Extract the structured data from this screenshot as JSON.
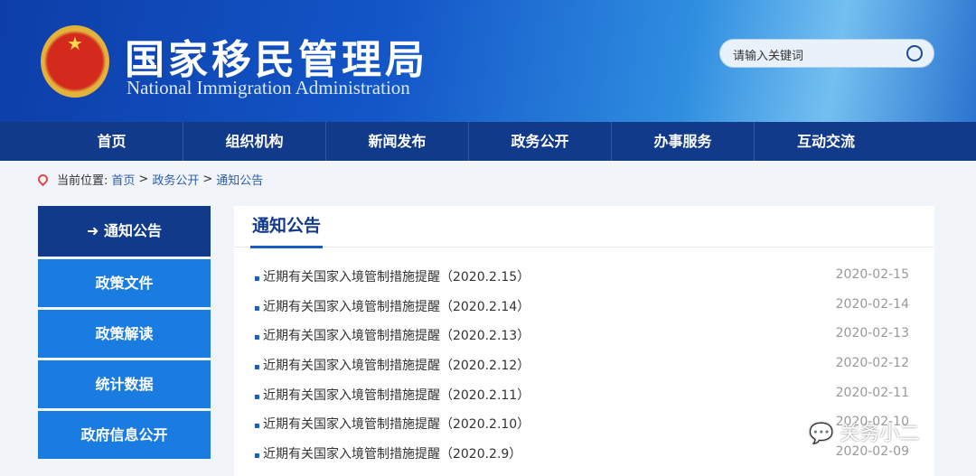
{
  "header": {
    "title": "国家移民管理局",
    "subtitle": "National Immigration Administration",
    "search_placeholder": "请输入关键词"
  },
  "nav": [
    "首页",
    "组织机构",
    "新闻发布",
    "政务公开",
    "办事服务",
    "互动交流"
  ],
  "breadcrumb": {
    "label": "当前位置:",
    "items": [
      "首页",
      "政务公开",
      "通知公告"
    ],
    "sep": ">"
  },
  "sidebar": [
    "通知公告",
    "政策文件",
    "政策解读",
    "统计数据",
    "政府信息公开"
  ],
  "main": {
    "title": "通知公告",
    "items": [
      {
        "title": "近期有关国家入境管制措施提醒（2020.2.15）",
        "date": "2020-02-15"
      },
      {
        "title": "近期有关国家入境管制措施提醒（2020.2.14）",
        "date": "2020-02-14"
      },
      {
        "title": "近期有关国家入境管制措施提醒（2020.2.13）",
        "date": "2020-02-13"
      },
      {
        "title": "近期有关国家入境管制措施提醒（2020.2.12）",
        "date": "2020-02-12"
      },
      {
        "title": "近期有关国家入境管制措施提醒（2020.2.11）",
        "date": "2020-02-11"
      },
      {
        "title": "近期有关国家入境管制措施提醒（2020.2.10）",
        "date": "2020-02-10"
      },
      {
        "title": "近期有关国家入境管制措施提醒（2020.2.9）",
        "date": "2020-02-09"
      }
    ]
  },
  "watermark": "关务小二"
}
